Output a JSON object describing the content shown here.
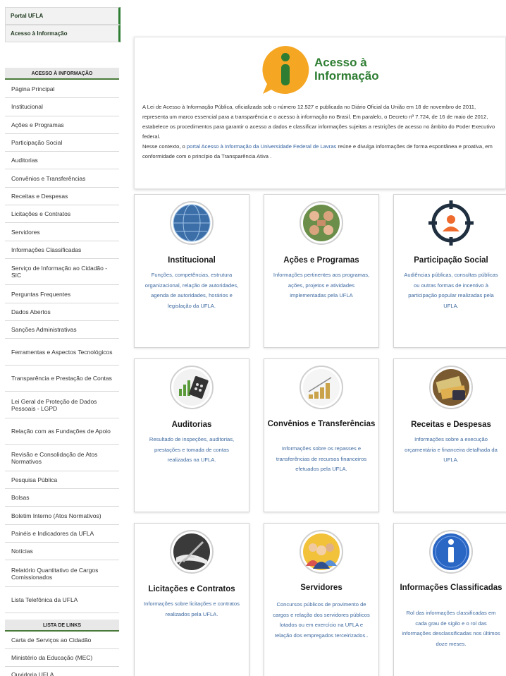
{
  "top_links": [
    "Portal UFLA",
    "Acesso à Informação"
  ],
  "sidebar_section_title": "ACESSO À INFORMAÇÃO",
  "sidebar_items": [
    "Página Principal",
    "Institucional",
    "Ações e Programas",
    "Participação Social",
    "Auditorias",
    "Convênios e Transferências",
    "Receitas e Despesas",
    "Licitações e Contratos",
    "Servidores",
    "Informações Classificadas",
    "Serviço de Informação ao Cidadão - SIC",
    "Perguntas Frequentes",
    "Dados Abertos",
    "Sanções Administrativas",
    "Ferramentas e Aspectos Tecnológicos",
    "Transparência e Prestação de Contas",
    "Lei Geral de Proteção de Dados Pessoais - LGPD",
    "Relação com as Fundações de Apoio",
    "Revisão e Consolidação de Atos Normativos",
    "Pesquisa Pública",
    "Bolsas",
    "Boletim Interno (Atos Normativos)",
    "Painéis e Indicadores da UFLA",
    "Notícias",
    "Relatório Quantitativo de Cargos Comissionados",
    "Lista Telefônica da UFLA"
  ],
  "links_section_title": "LISTA DE LINKS",
  "links_items": [
    "Carta de Serviços ao Cidadão",
    "Ministério da Educação (MEC)",
    "Ouvidoria UFLA"
  ],
  "intro": {
    "logo_line1": "Acesso à",
    "logo_line2": "Informação",
    "paragraph1": "A Lei de Acesso à Informação Pública, oficializada sob o número 12.527 e publicada no Diário Oficial da União em 18 de novembro de 2011, representa um marco essencial para a transparência e o acesso à informação no Brasil. Em paralelo, o Decreto nº 7.724, de 16 de maio de 2012, estabelece os procedimentos para garantir o acesso a dados e classificar informações sujeitas a restrições de acesso no âmbito do Poder Executivo federal.",
    "p2_before": "Nesse contexto, o ",
    "p2_link": "portal Acesso à Informação da Universidade Federal de Lavras",
    "p2_after": " reúne e divulga informações de forma espontânea e proativa, em conformidade com o princípio da Transparência Ativa ."
  },
  "cards": [
    {
      "title": "Institucional",
      "desc": "Funções, competências, estrutura organizacional, relação de autoridades, agenda de autoridades, horários e legislação da UFLA."
    },
    {
      "title": "Ações e Programas",
      "desc": "Informações pertinentes aos programas, ações, projetos e atividades implementadas pela UFLA"
    },
    {
      "title": "Participação Social",
      "desc": "Audiências públicas, consultas públicas ou outras formas de incentivo à participação popular realizadas pela UFLA."
    },
    {
      "title": "Auditorias",
      "desc": "Resultado de inspeções, auditorias, prestações e tomada de contas realizadas na UFLA."
    },
    {
      "title": "Convênios e Transferências",
      "desc": "Informações sobre os repasses e transferências de recursos financeiros efetuados pela UFLA."
    },
    {
      "title": "Receitas e Despesas",
      "desc": "Informações sobre a execução orçamentária e financeira detalhada da UFLA."
    },
    {
      "title": "Licitações e Contratos",
      "desc": "Informações sobre licitações e contratos realizados pela UFLA."
    },
    {
      "title": "Servidores",
      "desc": "Concursos públicos de provimento de cargos e relação dos servidores públicos lotados ou em exercício na UFLA e relação dos empregados terceirizados.."
    },
    {
      "title": "Informações Classificadas",
      "desc": "Rol das informações classificadas em cada grau de sigilo e o rol das informações desclassificadas nos últimos doze meses."
    }
  ],
  "colors": {
    "brand_green": "#2e7d32",
    "logo_orange": "#f5a623",
    "link_blue": "#3f6aa0"
  }
}
